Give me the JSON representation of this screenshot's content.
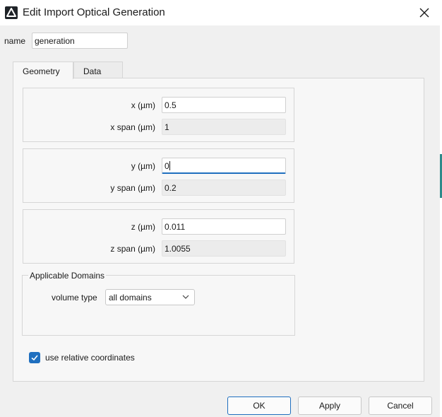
{
  "window": {
    "title": "Edit Import Optical Generation",
    "app_icon": "triangle-logo-icon",
    "close_icon": "close-icon"
  },
  "name_field": {
    "label": "name",
    "value": "generation"
  },
  "tabs": [
    {
      "label": "Geometry",
      "active": true
    },
    {
      "label": "Data",
      "active": false
    }
  ],
  "geometry": {
    "x": {
      "label": "x (µm)",
      "value": "0.5"
    },
    "x_span": {
      "label": "x span (µm)",
      "value": "1"
    },
    "y": {
      "label": "y (µm)",
      "value": "0"
    },
    "y_span": {
      "label": "y span (µm)",
      "value": "0.2"
    },
    "z": {
      "label": "z (µm)",
      "value": "0.011"
    },
    "z_span": {
      "label": "z span (µm)",
      "value": "1.0055"
    }
  },
  "applicable_domains": {
    "legend": "Applicable Domains",
    "volume_type_label": "volume type",
    "volume_type_value": "all domains"
  },
  "use_relative_coordinates": {
    "label": "use relative coordinates",
    "checked": true
  },
  "buttons": {
    "ok": "OK",
    "apply": "Apply",
    "cancel": "Cancel"
  },
  "colors": {
    "accent": "#1f6fbf",
    "panel": "#f7f7f7",
    "window": "#f0f0f0"
  }
}
